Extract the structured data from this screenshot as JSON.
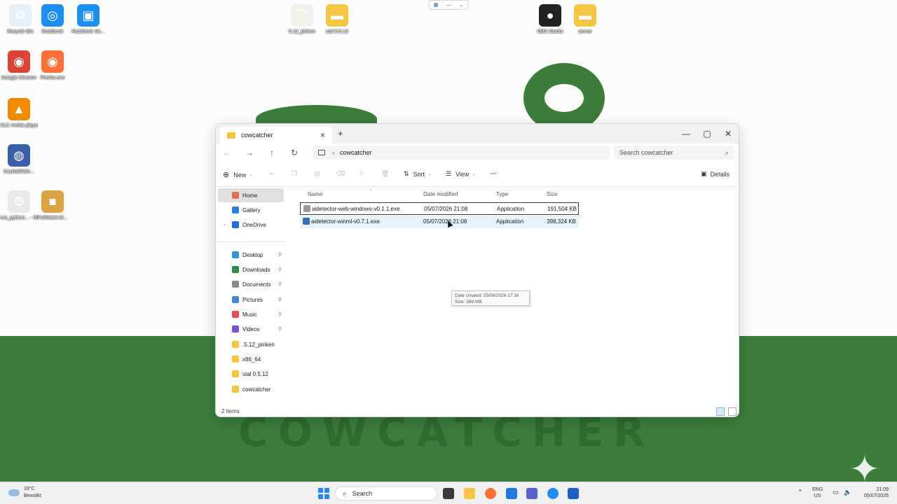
{
  "desktop": {
    "icons": [
      {
        "label": "Recycle Bin",
        "color": "#e6eef8",
        "glyph": "♻"
      },
      {
        "label": "RustDesk",
        "color": "#1d8ef0",
        "glyph": "◎"
      },
      {
        "label": "RustDesk Se...",
        "color": "#1d8ef0",
        "glyph": "▣"
      },
      {
        "label": "5.12_pinken",
        "color": "#f1f1ea",
        "glyph": "⌒"
      },
      {
        "label": "stal 0.5.12",
        "color": "#f4c542",
        "glyph": "▬"
      },
      {
        "label": "OBS Studio",
        "color": "#222222",
        "glyph": "●"
      },
      {
        "label": "server",
        "color": "#f4c542",
        "glyph": "▬"
      },
      {
        "label": "Google Chrome",
        "color": "#db4437",
        "glyph": "◉"
      },
      {
        "label": "Firefox.exe",
        "color": "#ff7139",
        "glyph": "◉"
      },
      {
        "label": "VLC media player",
        "color": "#f08a00",
        "glyph": "▲"
      },
      {
        "label": "CrystalDiskI...",
        "color": "#3b5fa8",
        "glyph": "◍"
      },
      {
        "label": "run_python... - Shortcut",
        "color": "#e8e8e8",
        "glyph": "⚙"
      },
      {
        "label": "FullStack.M...",
        "color": "#d9a441",
        "glyph": "■"
      }
    ],
    "wallpaper_text": "COWCATCHER"
  },
  "window": {
    "tab_title": "cowcatcher",
    "address": "cowcatcher",
    "search_placeholder": "Search cowcatcher",
    "toolbar": {
      "new_label": "New",
      "sort_label": "Sort",
      "view_label": "View",
      "more_label": "···",
      "details_label": "Details"
    },
    "nav": [
      {
        "label": "Home",
        "color": "#e0724f",
        "pinned": false
      },
      {
        "label": "Gallery",
        "color": "#2f7de1",
        "pinned": false
      },
      {
        "label": "OneDrive",
        "color": "#1f6fd6",
        "pinned": false
      },
      {
        "label": "Desktop",
        "color": "#3d8fdc",
        "pinned": true
      },
      {
        "label": "Downloads",
        "color": "#2b8a4e",
        "pinned": true
      },
      {
        "label": "Documents",
        "color": "#8a8a8a",
        "pinned": true
      },
      {
        "label": "Pictures",
        "color": "#3f86d8",
        "pinned": true
      },
      {
        "label": "Music",
        "color": "#e05252",
        "pinned": true
      },
      {
        "label": "Videos",
        "color": "#7b4fd1",
        "pinned": true
      },
      {
        "label": ".5.12_pinken",
        "color": "#f4c542",
        "pinned": false
      },
      {
        "label": "x86_64",
        "color": "#f4c542",
        "pinned": false
      },
      {
        "label": "stal 0.5.12",
        "color": "#f4c542",
        "pinned": false
      },
      {
        "label": "cowcatcher",
        "color": "#f4c542",
        "pinned": false
      }
    ],
    "columns": {
      "name": "Name",
      "date": "Date modified",
      "type": "Type",
      "size": "Size"
    },
    "files": [
      {
        "name": "aidetector-web-windows-v0.1.1.exe",
        "date": "05/07/2026 21:08",
        "type": "Application",
        "size": "191,504 KB",
        "color": "#9a9a9a"
      },
      {
        "name": "aidetector-winml-v0.7.1.exe",
        "date": "05/07/2026 21:08",
        "type": "Application",
        "size": "398,324 KB",
        "color": "#3a6fb8"
      }
    ],
    "tooltip": {
      "created": "Date created: 25/06/2026 17:16",
      "size": "Size: 388 MB"
    },
    "item_count": "2 items"
  },
  "taskbar": {
    "temperature": "19°C",
    "weather": "Bewolkt",
    "search_label": "Search",
    "lang_top": "ENG",
    "lang_bottom": "US",
    "time": "21:09",
    "date": "05/07/2026"
  }
}
